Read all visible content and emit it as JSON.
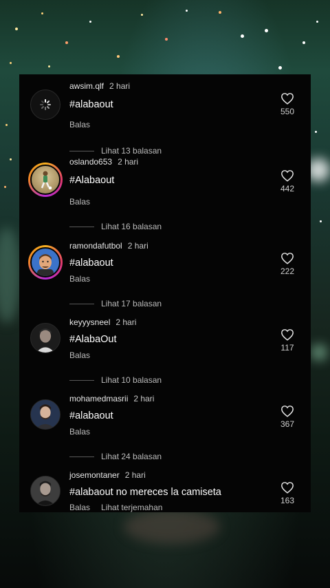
{
  "comments": [
    {
      "username": "awsim.qlf",
      "time": "2 hari",
      "text": "#alabaout",
      "reply_label": "Balas",
      "likes": "550",
      "view_replies": "Lihat 13 balasan",
      "avatar_icon": "loading-spinner-icon"
    },
    {
      "username": "oslando653",
      "time": "2 hari",
      "text": "#Alabaout",
      "reply_label": "Balas",
      "likes": "442",
      "view_replies": "Lihat 16 balasan",
      "avatar_icon": "football-player-icon"
    },
    {
      "username": "ramondafutbol",
      "time": "2 hari",
      "text": "#alabaout",
      "reply_label": "Balas",
      "likes": "222",
      "view_replies": "Lihat 17 balasan",
      "avatar_icon": "cartoon-avatar-icon"
    },
    {
      "username": "keyyysneel",
      "time": "2 hari",
      "text": "#AlabaOut",
      "reply_label": "Balas",
      "likes": "117",
      "view_replies": "Lihat 10 balasan",
      "avatar_icon": "person-photo-icon"
    },
    {
      "username": "mohamedmasrii",
      "time": "2 hari",
      "text": "#alabaout",
      "reply_label": "Balas",
      "likes": "367",
      "view_replies": "Lihat 24 balasan",
      "avatar_icon": "person-photo-icon"
    },
    {
      "username": "josemontaner",
      "time": "2 hari",
      "text": "#alabaout no mereces la camiseta",
      "reply_label": "Balas",
      "translate_label": "Lihat terjemahan",
      "likes": "163",
      "avatar_icon": "person-photo-icon"
    }
  ],
  "colors": {
    "panel": "#050505",
    "text": "#ffffff",
    "muted": "#bdbdbd",
    "ring_gradient": [
      "#f5b01f",
      "#e13b6b",
      "#b52ad6"
    ]
  }
}
